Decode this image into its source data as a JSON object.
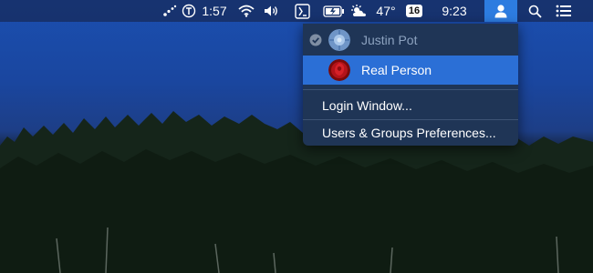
{
  "menubar": {
    "time": "1:57",
    "battery_percent_label": "",
    "weather_temp": "47°",
    "calendar_date": "16",
    "clock": "9:23",
    "icons": [
      "tether-icon",
      "time-machine-icon",
      "wifi-icon",
      "volume-icon",
      "text-input-icon",
      "battery-icon",
      "weather-icon",
      "user-icon",
      "spotlight-icon",
      "notification-center-icon"
    ]
  },
  "user_menu": {
    "current_user": "Justin Pot",
    "selected_user": "Real Person",
    "login_window": "Login Window...",
    "preferences": "Users & Groups Preferences..."
  },
  "colors": {
    "menu_bg": "#1f3556",
    "highlight": "#2b6fd6",
    "menubar_active": "#2d7ce0"
  }
}
